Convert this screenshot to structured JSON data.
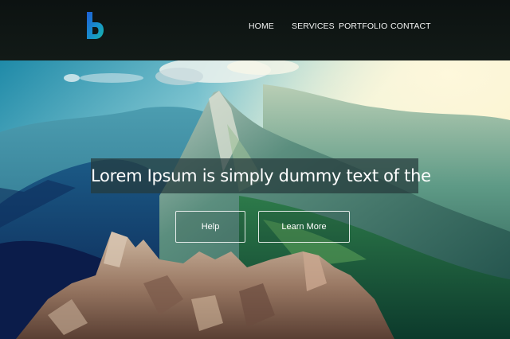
{
  "header": {
    "logo_icon": "b-logo-icon",
    "nav": {
      "home": "HOME",
      "services": "SERVICES",
      "portfolio": "PORTFOLIO",
      "contact": "CONTACT"
    }
  },
  "hero": {
    "headline": "Lorem Ipsum is simply dummy text of the",
    "buttons": {
      "help": "Help",
      "learn_more": "Learn More"
    }
  },
  "colors": {
    "header_bg": "#0c1211",
    "logo_blue": "#1d6fd6",
    "logo_teal": "#17b4a8",
    "headline_box": "#263a3c"
  }
}
